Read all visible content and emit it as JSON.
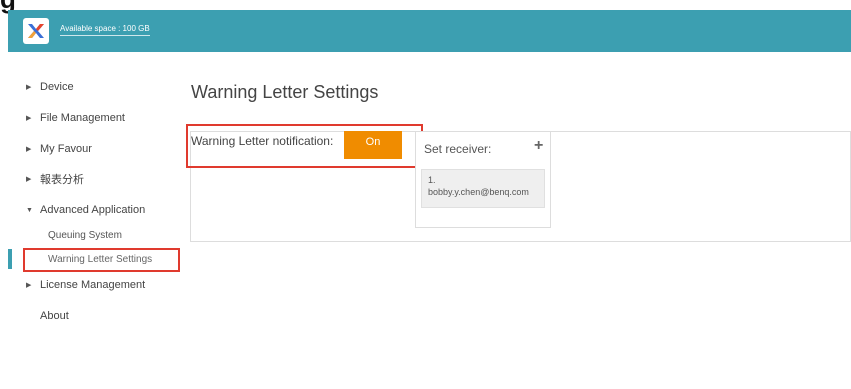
{
  "header": {
    "space_label": "Available space : 100 GB",
    "cut_glyph": "g"
  },
  "sidebar": {
    "items": [
      {
        "label": "Device"
      },
      {
        "label": "File Management"
      },
      {
        "label": "My Favour"
      },
      {
        "label": "報表分析"
      },
      {
        "label": "Advanced Application"
      },
      {
        "label": "License Management"
      },
      {
        "label": "About"
      }
    ],
    "subitems": [
      {
        "label": "Queuing System"
      },
      {
        "label": "Warning Letter Settings"
      }
    ]
  },
  "main": {
    "title": "Warning Letter Settings",
    "notification_label": "Warning Letter notification:",
    "toggle_label": "On",
    "receiver_label": "Set receiver:",
    "add_symbol": "+",
    "receivers": [
      {
        "index": "1.",
        "email": "bobby.y.chen@benq.com"
      }
    ]
  },
  "colors": {
    "header_bg": "#3c9fb1",
    "toggle_on": "#f08c00",
    "highlight_box": "#e03a2e"
  }
}
